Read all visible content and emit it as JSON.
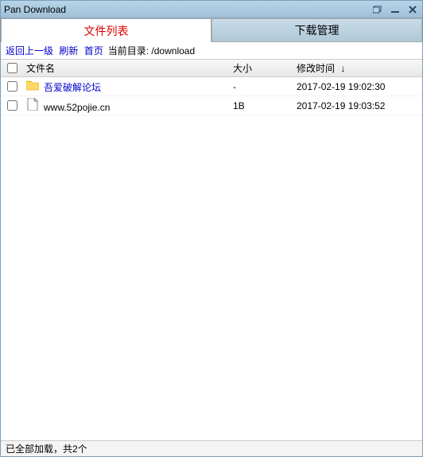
{
  "window": {
    "title": "Pan Download"
  },
  "tabs": {
    "file_list": "文件列表",
    "download_mgr": "下载管理"
  },
  "toolbar": {
    "back": "返回上一级",
    "refresh": "刷新",
    "home": "首页",
    "curdir_label": "当前目录:",
    "curdir_path": "/download"
  },
  "columns": {
    "name": "文件名",
    "size": "大小",
    "time": "修改时间",
    "sort_indicator": "↓"
  },
  "rows": [
    {
      "type": "folder",
      "name": "吾爱破解论坛",
      "size": "-",
      "time": "2017-02-19 19:02:30",
      "is_link": true
    },
    {
      "type": "file",
      "name": "www.52pojie.cn",
      "size": "1B",
      "time": "2017-02-19 19:03:52",
      "is_link": false
    }
  ],
  "status": "已全部加载，共2个"
}
